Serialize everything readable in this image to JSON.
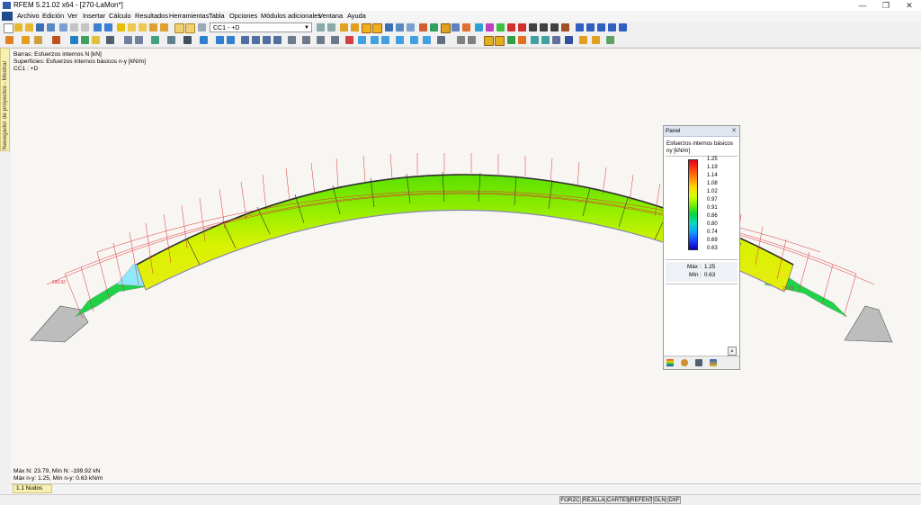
{
  "window": {
    "title": "RFEM 5.21.02 x64 - [270-LaMon*]"
  },
  "menu": [
    "Archivo",
    "Edición",
    "Ver",
    "Insertar",
    "Cálculo",
    "Resultados",
    "Herramientas",
    "Tabla",
    "Opciones",
    "Módulos adicionales",
    "Ventana",
    "Ayuda"
  ],
  "toolbar": {
    "load_case": "CC1 - +D"
  },
  "navigator": {
    "label": "Navegador de proyectos - Mostrar"
  },
  "viewport_info": {
    "line1": "Barras: Esfuerzos internos N [kN]",
    "line2": "Superficies: Esfuerzos internos básicos n-y [kN/m]",
    "line3": "CC1 : +D",
    "footer1": "Máx N: 23.79, Mín N: -199.92 kN",
    "footer2": "Máx n-y: 1.25, Mín n-y: 0.63 kN/m"
  },
  "model_labels": {
    "left": "-199.92",
    "right": "23.79"
  },
  "panel": {
    "title": "Panel",
    "subtitle": "Esfuerzos internos básicos",
    "quantity": "ny [kN/m]",
    "scale_values": [
      "1.25",
      "1.19",
      "1.14",
      "1.08",
      "1.02",
      "0.97",
      "0.91",
      "0.86",
      "0.80",
      "0.74",
      "0.69",
      "0.63"
    ],
    "max_label": "Máx",
    "max_value": "1.25",
    "min_label": "Mín",
    "min_value": "0.63"
  },
  "bottom_tab": "1.1 Nudos",
  "status_buttons": [
    "FORZC",
    "REJILLA",
    "CARTES",
    "REFENT",
    "GLN",
    "DXF"
  ],
  "colors": {
    "accent": "#2e5ea8",
    "member_diagram": "#e0303a",
    "nav_tab": "#f7f0b0"
  }
}
